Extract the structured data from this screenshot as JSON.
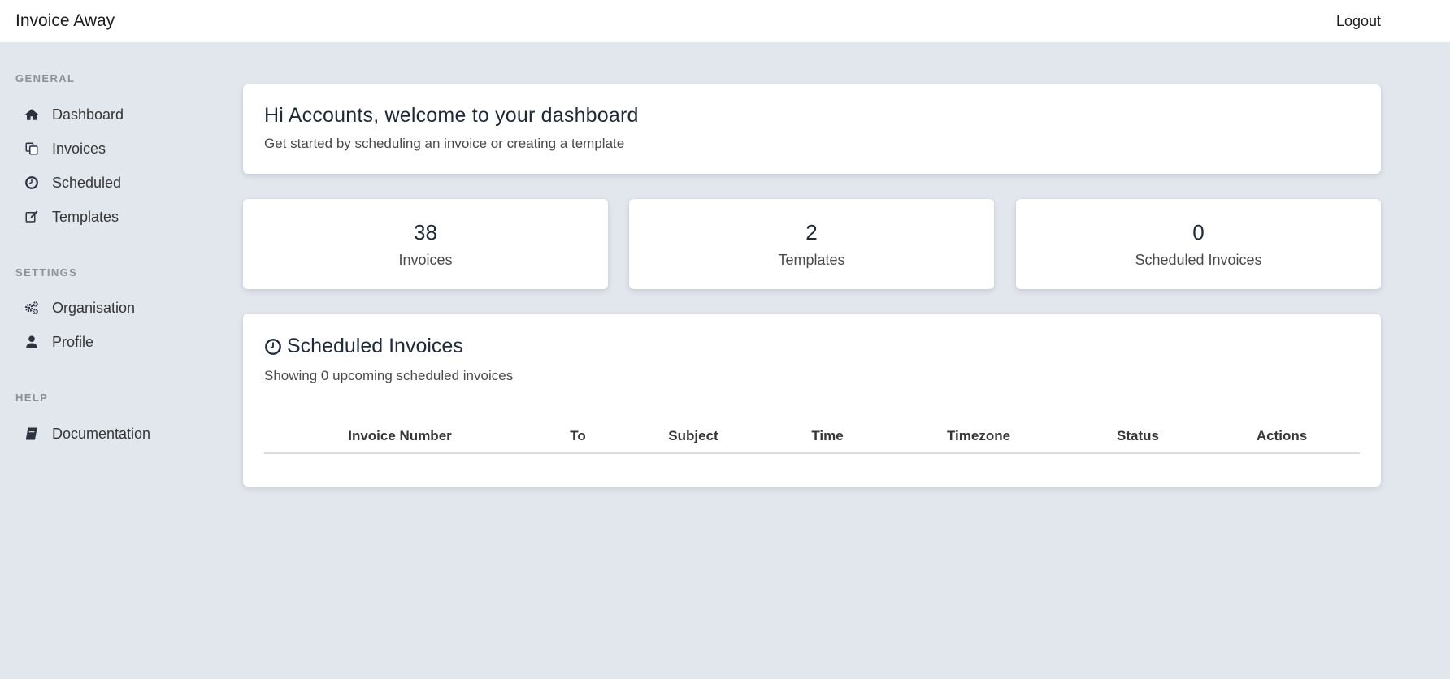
{
  "app": {
    "title": "Invoice Away",
    "logout_label": "Logout"
  },
  "sidebar": {
    "sections": [
      {
        "label": "General",
        "items": [
          {
            "label": "Dashboard",
            "icon": "home-icon"
          },
          {
            "label": "Invoices",
            "icon": "copy-icon"
          },
          {
            "label": "Scheduled",
            "icon": "clock-icon"
          },
          {
            "label": "Templates",
            "icon": "edit-icon"
          }
        ]
      },
      {
        "label": "Settings",
        "items": [
          {
            "label": "Organisation",
            "icon": "cogs-icon"
          },
          {
            "label": "Profile",
            "icon": "user-icon"
          }
        ]
      },
      {
        "label": "Help",
        "items": [
          {
            "label": "Documentation",
            "icon": "book-icon"
          }
        ]
      }
    ]
  },
  "welcome": {
    "title": "Hi Accounts, welcome to your dashboard",
    "subtitle": "Get started by scheduling an invoice or creating a template"
  },
  "stats": [
    {
      "value": "38",
      "label": "Invoices"
    },
    {
      "value": "2",
      "label": "Templates"
    },
    {
      "value": "0",
      "label": "Scheduled Invoices"
    }
  ],
  "scheduled": {
    "title": "Scheduled Invoices",
    "subtitle": "Showing 0 upcoming scheduled invoices",
    "columns": [
      "Invoice Number",
      "To",
      "Subject",
      "Time",
      "Timezone",
      "Status",
      "Actions"
    ]
  },
  "colors": {
    "background": "#e2e7ed",
    "card": "#ffffff",
    "text_dark": "#1f2937",
    "menu_label": "#8a8f98"
  }
}
